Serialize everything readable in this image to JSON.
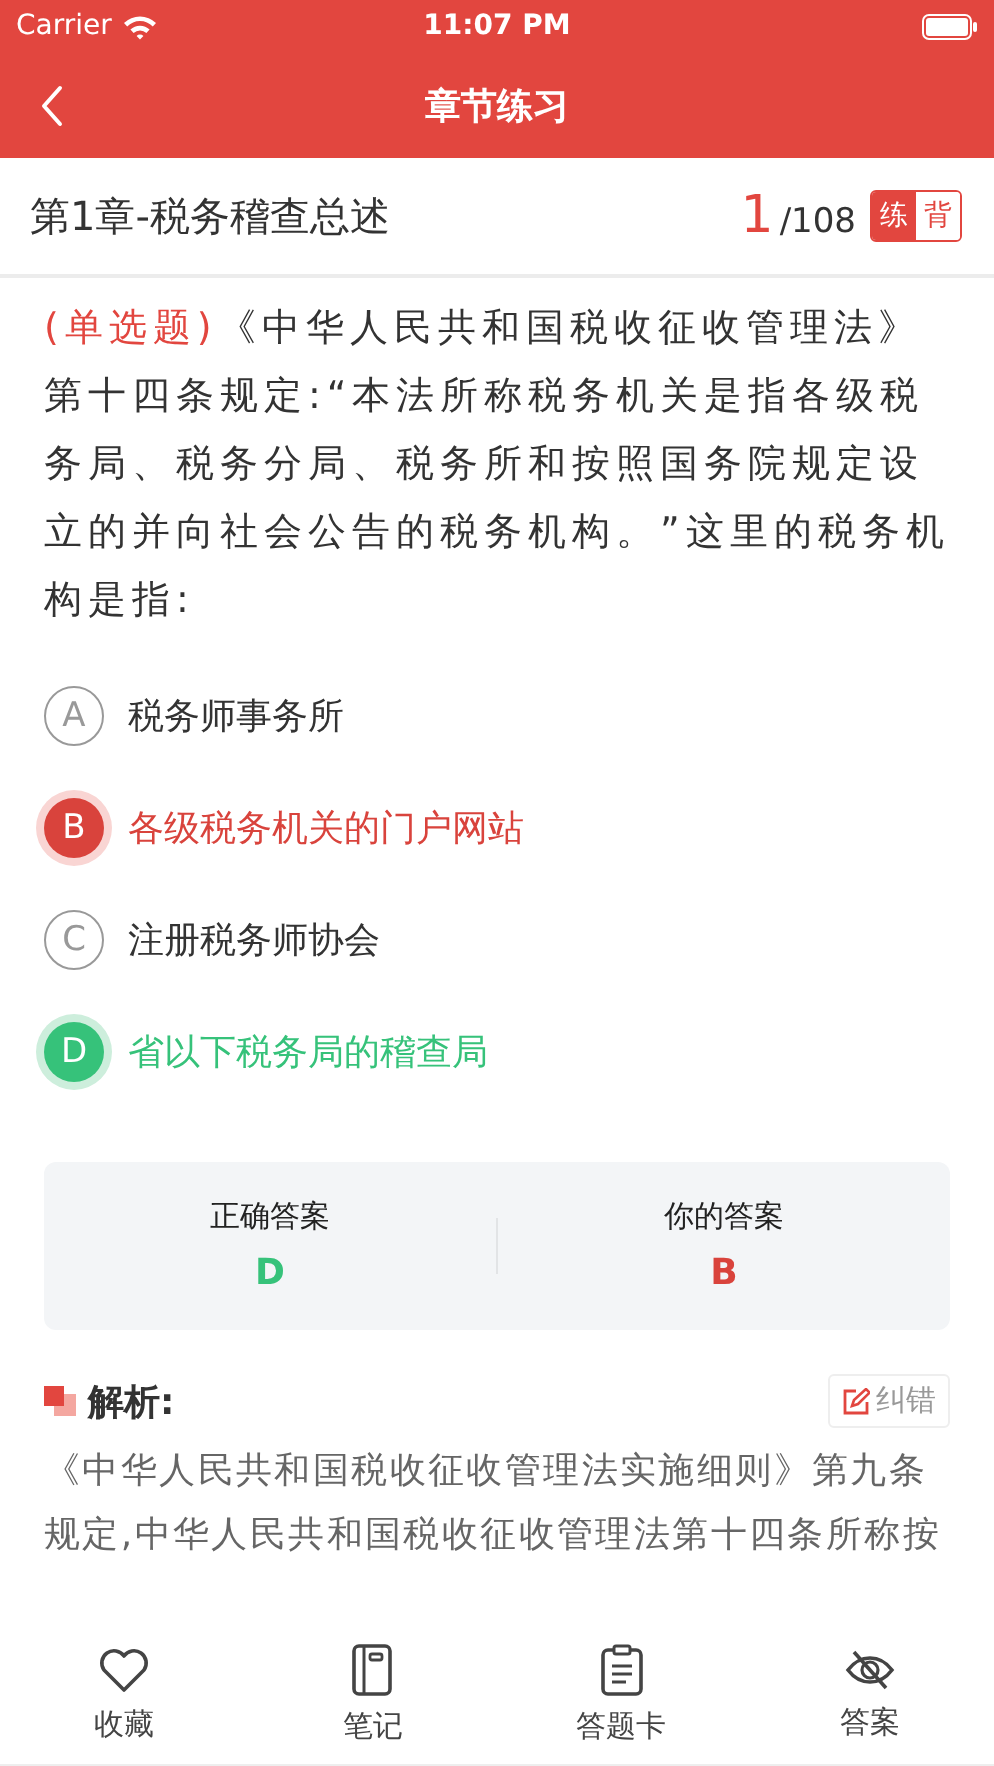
{
  "status_bar": {
    "carrier": "Carrier",
    "time": "11:07 PM"
  },
  "nav": {
    "title": "章节练习"
  },
  "chapter": {
    "title": "第1章-税务稽查总述",
    "current": "1",
    "total": "/108",
    "modes": [
      {
        "label": "练",
        "selected": true
      },
      {
        "label": "背",
        "selected": false
      }
    ]
  },
  "question": {
    "type_label": "(单选题)",
    "text": "《中华人民共和国税收征收管理法》第十四条规定:“本法所称税务机关是指各级税务局、税务分局、税务所和按照国务院规定设立的并向社会公告的税务机构。”这里的税务机构是指:"
  },
  "options": [
    {
      "letter": "A",
      "text": "税务师事务所",
      "kind": "plain"
    },
    {
      "letter": "B",
      "text": "各级税务机关的门户网站",
      "kind": "wrong"
    },
    {
      "letter": "C",
      "text": "注册税务师协会",
      "kind": "plain"
    },
    {
      "letter": "D",
      "text": "省以下税务局的稽查局",
      "kind": "correct"
    }
  ],
  "answer_card": {
    "correct_label": "正确答案",
    "correct": "D",
    "yours_label": "你的答案",
    "yours": "B"
  },
  "analysis": {
    "title": "解析:",
    "report_button": "纠错",
    "text": "《中华人民共和国税收征收管理法实施细则》第九条规定,中华人民共和国税收征收管理法第十四条所称按"
  },
  "tab_bar": [
    {
      "label": "收藏",
      "kind": "favorite"
    },
    {
      "label": "笔记",
      "kind": "notes"
    },
    {
      "label": "答题卡",
      "kind": "card"
    },
    {
      "label": "答案",
      "kind": "answer"
    }
  ]
}
